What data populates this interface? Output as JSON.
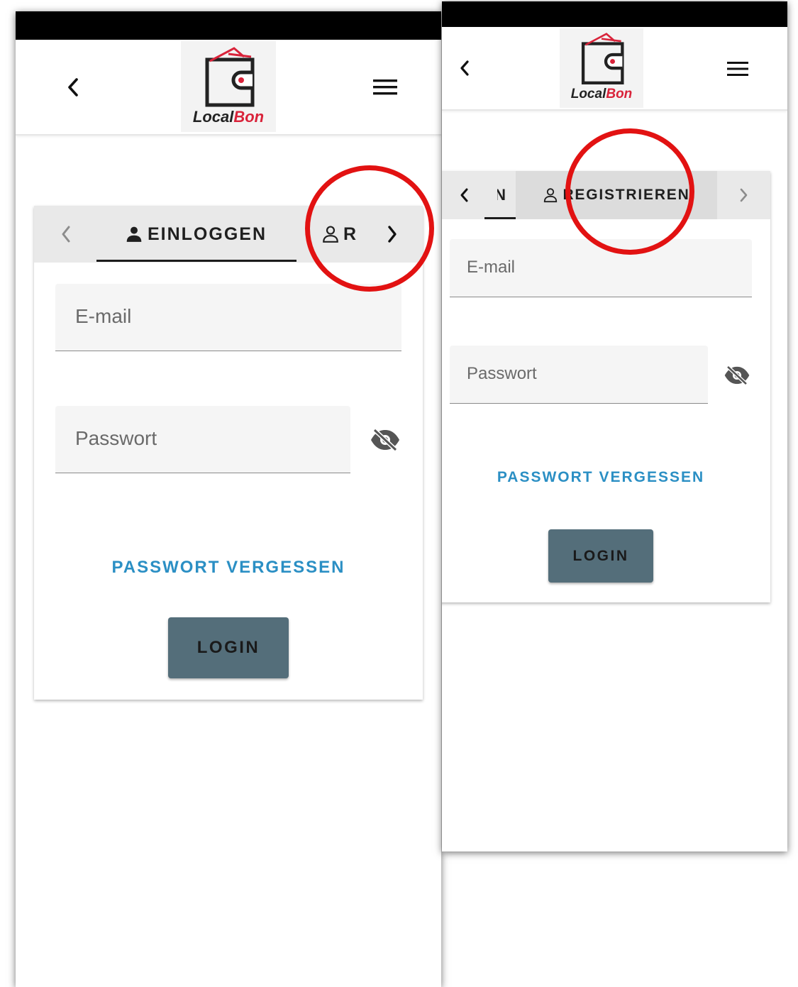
{
  "app": {
    "brand_part1": "Local",
    "brand_part2": "Bon",
    "brand_accent_color": "#d9233a"
  },
  "icons": {
    "back": "chevron-left-icon",
    "menu": "hamburger-menu-icon",
    "tab_prev": "chevron-left-icon",
    "tab_next": "chevron-right-icon",
    "login_tab": "person-icon",
    "register_tab": "person-outline-icon",
    "password_visibility": "eye-off-icon"
  },
  "left_screen": {
    "tabs": {
      "login_label": "EINLOGGEN",
      "register_label_truncated": "R"
    },
    "form": {
      "email_placeholder": "E-mail",
      "password_placeholder": "Passwort",
      "forgot_password": "PASSWORT VERGESSEN",
      "login_button": "LOGIN"
    }
  },
  "right_screen": {
    "tabs": {
      "login_label_clipped": "N",
      "register_label": "REGISTRIEREN"
    },
    "form": {
      "email_placeholder": "E-mail",
      "password_placeholder": "Passwort",
      "forgot_password": "PASSWORT VERGESSEN",
      "login_button": "LOGIN"
    }
  },
  "colors": {
    "link": "#2b8fc4",
    "button": "#546e7a",
    "highlight": "#e21212"
  }
}
